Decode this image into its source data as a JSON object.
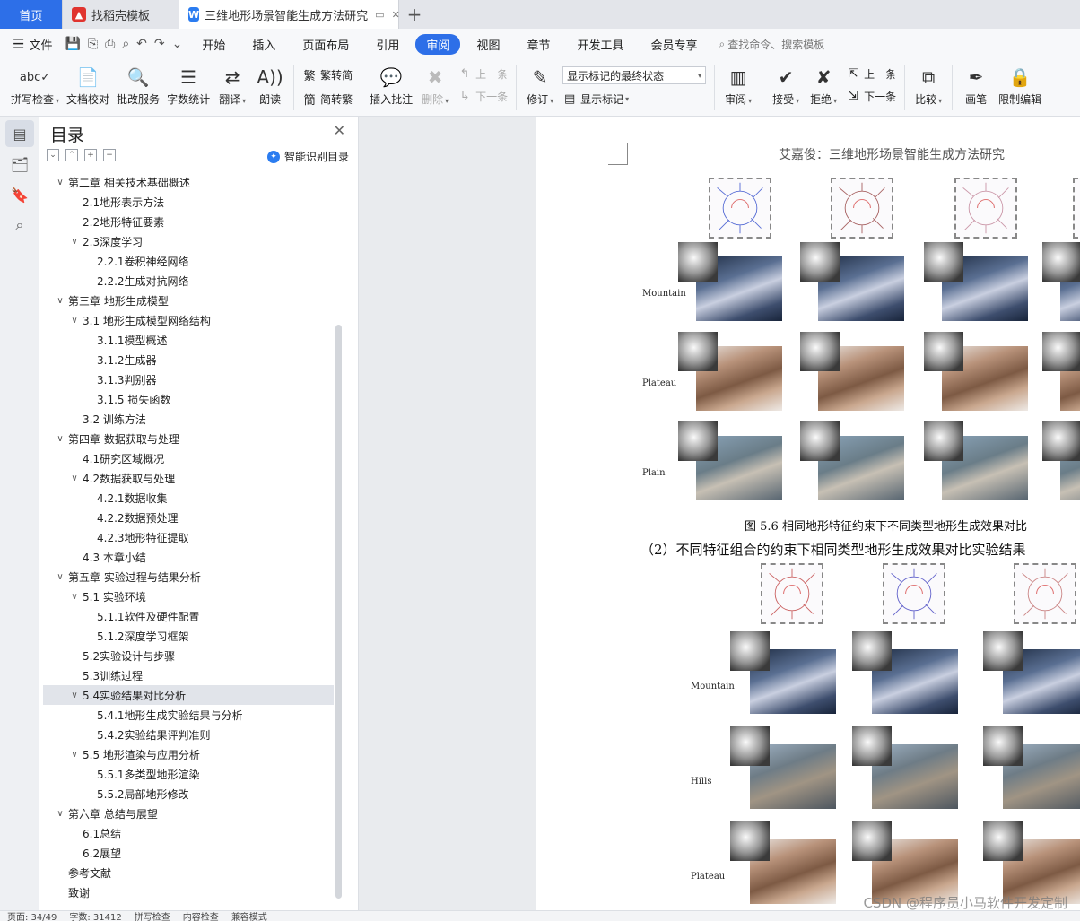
{
  "tabs": {
    "home": "首页",
    "store": "找稻壳模板",
    "doc": "三维地形场景智能生成方法研究"
  },
  "menu": {
    "file": "文件",
    "items": [
      "开始",
      "插入",
      "页面布局",
      "引用",
      "审阅",
      "视图",
      "章节",
      "开发工具",
      "会员专享"
    ],
    "active": "审阅",
    "search": "查找命令、搜索模板"
  },
  "ribbon": {
    "spell": "拼写检查",
    "proof": "文档校对",
    "correct": "批改服务",
    "wordcount": "字数统计",
    "translate": "翻译",
    "read": "朗读",
    "to_trad": "繁转简",
    "to_simp": "简转繁",
    "insert_comment": "插入批注",
    "delete": "删除",
    "prev": "上一条",
    "next": "下一条",
    "revise": "修订",
    "markup_state": "显示标记的最终状态",
    "show_markup": "显示标记",
    "review": "审阅",
    "accept": "接受",
    "reject": "拒绝",
    "prev2": "上一条",
    "next2": "下一条",
    "compare": "比较",
    "pen": "画笔",
    "restrict": "限制编辑"
  },
  "toc": {
    "title": "目录",
    "smart": "智能识别目录",
    "items": [
      {
        "label": "第二章 相关技术基础概述",
        "level": 1,
        "toggle": "v"
      },
      {
        "label": "2.1地形表示方法",
        "level": 2,
        "toggle": ""
      },
      {
        "label": "2.2地形特征要素",
        "level": 2,
        "toggle": ""
      },
      {
        "label": "2.3深度学习",
        "level": 2,
        "toggle": "v"
      },
      {
        "label": "2.2.1卷积神经网络",
        "level": 3,
        "toggle": ""
      },
      {
        "label": "2.2.2生成对抗网络",
        "level": 3,
        "toggle": ""
      },
      {
        "label": "第三章 地形生成模型",
        "level": 1,
        "toggle": "v"
      },
      {
        "label": "3.1 地形生成模型网络结构",
        "level": 2,
        "toggle": "v"
      },
      {
        "label": "3.1.1模型概述",
        "level": 3,
        "toggle": ""
      },
      {
        "label": "3.1.2生成器",
        "level": 3,
        "toggle": ""
      },
      {
        "label": "3.1.3判别器",
        "level": 3,
        "toggle": ""
      },
      {
        "label": "3.1.5 损失函数",
        "level": 3,
        "toggle": ""
      },
      {
        "label": "3.2 训练方法",
        "level": 2,
        "toggle": ""
      },
      {
        "label": "第四章 数据获取与处理",
        "level": 1,
        "toggle": "v"
      },
      {
        "label": "4.1研究区域概况",
        "level": 2,
        "toggle": ""
      },
      {
        "label": "4.2数据获取与处理",
        "level": 2,
        "toggle": "v"
      },
      {
        "label": "4.2.1数据收集",
        "level": 3,
        "toggle": ""
      },
      {
        "label": "4.2.2数据预处理",
        "level": 3,
        "toggle": ""
      },
      {
        "label": "4.2.3地形特征提取",
        "level": 3,
        "toggle": ""
      },
      {
        "label": "4.3 本章小结",
        "level": 2,
        "toggle": ""
      },
      {
        "label": "第五章 实验过程与结果分析",
        "level": 1,
        "toggle": "v"
      },
      {
        "label": "5.1 实验环境",
        "level": 2,
        "toggle": "v"
      },
      {
        "label": "5.1.1软件及硬件配置",
        "level": 3,
        "toggle": ""
      },
      {
        "label": "5.1.2深度学习框架",
        "level": 3,
        "toggle": ""
      },
      {
        "label": "5.2实验设计与步骤",
        "level": 2,
        "toggle": ""
      },
      {
        "label": "5.3训练过程",
        "level": 2,
        "toggle": ""
      },
      {
        "label": "5.4实验结果对比分析",
        "level": 2,
        "toggle": "v",
        "selected": true
      },
      {
        "label": "5.4.1地形生成实验结果与分析",
        "level": 3,
        "toggle": ""
      },
      {
        "label": "5.4.2实验结果评判准则",
        "level": 3,
        "toggle": ""
      },
      {
        "label": "5.5 地形渲染与应用分析",
        "level": 2,
        "toggle": "v"
      },
      {
        "label": "5.5.1多类型地形渲染",
        "level": 3,
        "toggle": ""
      },
      {
        "label": "5.5.2局部地形修改",
        "level": 3,
        "toggle": ""
      },
      {
        "label": "第六章 总结与展望",
        "level": 1,
        "toggle": "v"
      },
      {
        "label": "6.1总结",
        "level": 2,
        "toggle": ""
      },
      {
        "label": "6.2展望",
        "level": 2,
        "toggle": ""
      },
      {
        "label": "参考文献",
        "level": 1,
        "toggle": ""
      },
      {
        "label": "致谢",
        "level": 1,
        "toggle": ""
      }
    ]
  },
  "doc": {
    "header": "艾嘉俊：三维地形场景智能生成方法研究",
    "fig1": {
      "labels": [
        "Mountain",
        "Plateau",
        "Plain"
      ]
    },
    "caption1": "图 5.6 相同地形特征约束下不同类型地形生成效果对比",
    "subheading": "（2）不同特征组合的约束下相同类型地形生成效果对比实验结果",
    "fig2": {
      "labels": [
        "Mountain",
        "Hills",
        "Plateau"
      ]
    }
  },
  "status": {
    "page": "页面: 34/49",
    "words": "字数: 31412",
    "spell": "拼写检查",
    "content": "内容检查",
    "compat": "兼容模式"
  },
  "watermark": "CSDN @程序员小马软件开发定制"
}
